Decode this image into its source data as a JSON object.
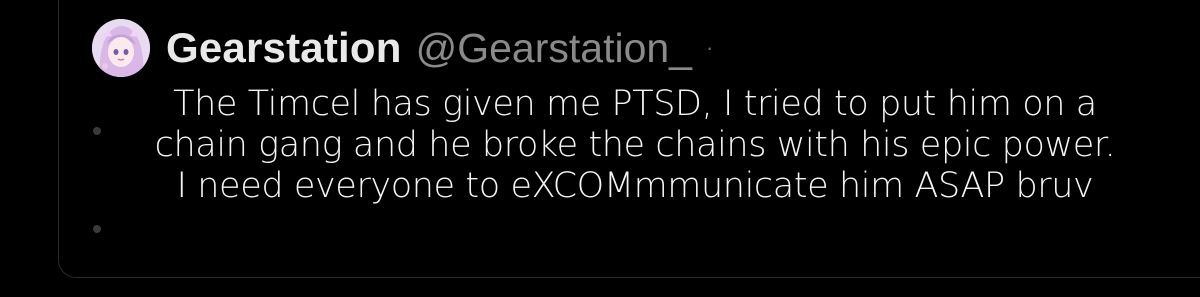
{
  "author": {
    "display_name": "Gearstation",
    "handle": "@Gearstation_",
    "separator": "·",
    "avatar_icon": "anime-avatar-icon"
  },
  "tweet": {
    "lines": [
      "The Timcel has given me PTSD, I tried to put him on a",
      "chain gang and he broke the chains with his epic power.",
      "I need everyone to eXCOMmmunicate him ASAP bruv"
    ]
  },
  "colors": {
    "background": "#000000",
    "display_name": "#e9e9e9",
    "handle": "#8a8a8a",
    "text": "#f4f4f4",
    "avatar_hair": "#d9b8e8"
  }
}
